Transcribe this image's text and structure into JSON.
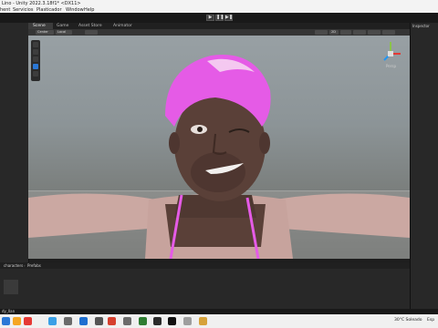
{
  "window": {
    "title": "Lino - Unity 2022.3.18f1* <DX11>"
  },
  "menu": [
    "hent",
    "Servicios",
    "Plasticador",
    "Window",
    "Help"
  ],
  "toolbar": {
    "play": "▶",
    "pause": "❚❚",
    "step": "▶❚"
  },
  "tabs": [
    "Scene",
    "Game",
    "Asset Store",
    "Animator"
  ],
  "scene_toolbar": {
    "shading": "Center",
    "pivot": "Local",
    "view2d": "2D"
  },
  "gizmo": {
    "label": "Persp"
  },
  "inspector": {
    "title": "Inspector"
  },
  "project": {
    "breadcrumb": [
      "characters",
      "Prefabs"
    ]
  },
  "status": {
    "text": "dy_llan"
  },
  "taskbar": {
    "weather": "30°C Soleado",
    "language": "Esp"
  },
  "colors": {
    "hair": "#e55be6",
    "skin": "#5a4038",
    "arm": "#cba8a2",
    "accent": "#2b78d6"
  }
}
